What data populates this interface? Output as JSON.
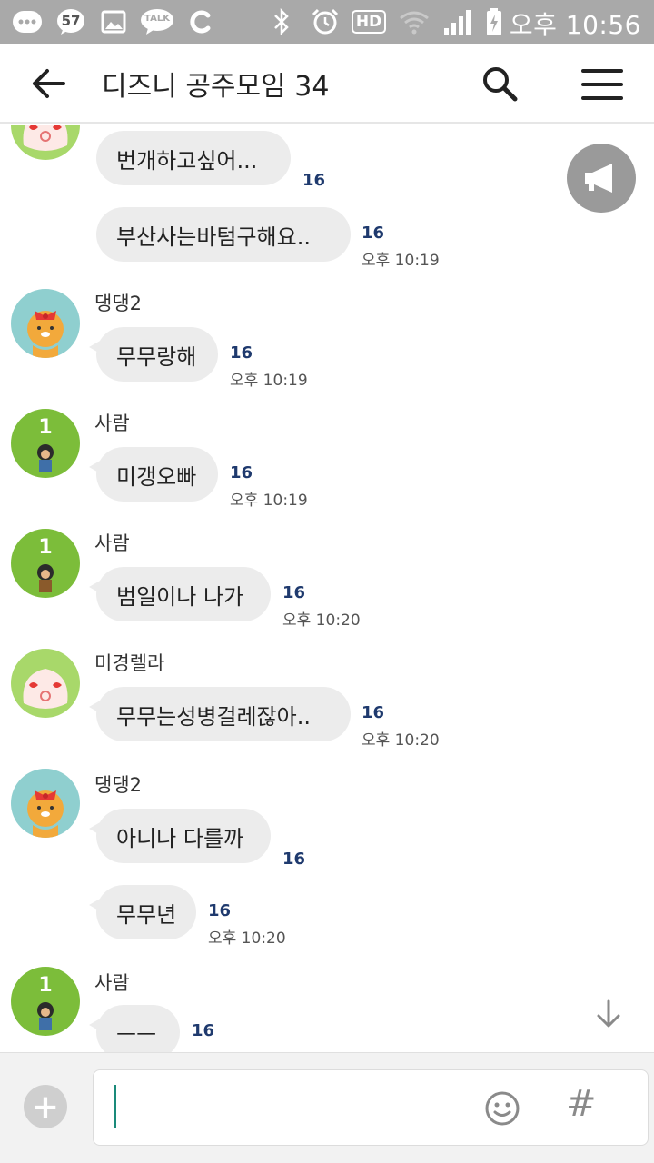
{
  "status_bar": {
    "time": "오후 10:56",
    "notification_count": "57",
    "talk_label": "TALK",
    "hd_label": "HD"
  },
  "header": {
    "title": "디즈니 공주모임 34"
  },
  "messages": [
    {
      "text": "번개하고싶어...",
      "unread": "16"
    },
    {
      "text": "부산사는바텀구해요..",
      "unread": "16",
      "time": "오후 10:19"
    },
    {
      "sender": "댕댕2",
      "text": "무무랑해",
      "unread": "16",
      "time": "오후 10:19"
    },
    {
      "sender": "사람",
      "avatar_number": "1",
      "text": "미갱오빠",
      "unread": "16",
      "time": "오후 10:19"
    },
    {
      "sender": "사람",
      "avatar_number": "1",
      "text": "범일이나 나가",
      "unread": "16",
      "time": "오후 10:20"
    },
    {
      "sender": "미경렐라",
      "text": "무무는성병걸레잖아..",
      "unread": "16",
      "time": "오후 10:20"
    },
    {
      "sender": "댕댕2",
      "text": "아니나 다를까",
      "unread": "16"
    },
    {
      "text": "무무년",
      "unread": "16",
      "time": "오후 10:20"
    },
    {
      "sender": "사람",
      "avatar_number": "1",
      "text": "ㅡㅡ",
      "unread": "16"
    }
  ],
  "colors": {
    "status_bar": "#a9a9a9",
    "bubble": "#ececec",
    "unread": "#1f3a6e",
    "avatar_green": "#7cbd3a",
    "avatar_teal": "#8fcfcf",
    "cursor": "#1a8a7a"
  },
  "icons": {
    "back": "back-arrow-icon",
    "search": "search-icon",
    "menu": "hamburger-menu-icon",
    "notice": "megaphone-icon",
    "scroll_down": "arrow-down-icon",
    "add": "plus-icon",
    "emoji": "emoticon-icon",
    "hashtag": "hashtag-icon"
  },
  "input": {
    "hash_symbol": "#",
    "plus_symbol": "+"
  }
}
